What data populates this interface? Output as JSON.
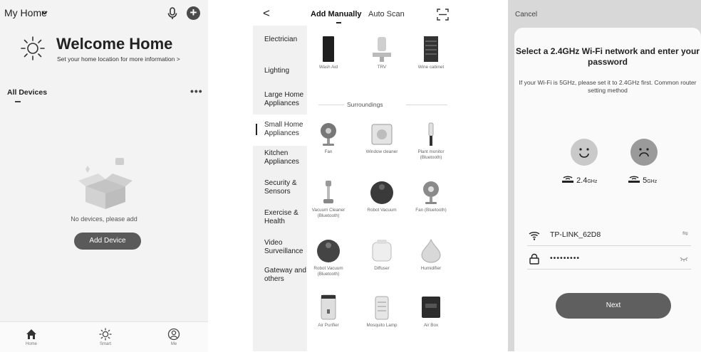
{
  "home": {
    "title": "My Home",
    "welcome": "Welcome Home",
    "location_hint": "Set your home location for more information >",
    "all_devices": "All Devices",
    "more": "•••",
    "empty_text": "No devices, please add",
    "add_device": "Add Device",
    "tabs": [
      {
        "label": "Home",
        "icon": "home-icon"
      },
      {
        "label": "Smart",
        "icon": "smart-sun-icon"
      },
      {
        "label": "Me",
        "icon": "profile-icon"
      }
    ]
  },
  "add": {
    "back": "<",
    "tab_manual": "Add Manually",
    "tab_auto": "Auto Scan",
    "categories": [
      "Electrician",
      "Lighting",
      "Large Home Appliances",
      "Small Home Appliances",
      "Kitchen Appliances",
      "Security & Sensors",
      "Exercise & Health",
      "Video Surveillance",
      "Gateway and others"
    ],
    "active_category": "Small Home Appliances",
    "top_items": [
      "Wash Aid",
      "TRV",
      "Wine cabinet"
    ],
    "section": "Surroundings",
    "items": [
      "Fan",
      "Window cleaner",
      "Plant monitor (Bluetooth)",
      "Vacuum Cleaner (Bluetooth)",
      "Robot Vacuum",
      "Fan (Bluetooth)",
      "Robot Vacuum (Bluetooth)",
      "Diffuser",
      "Humidifier",
      "Air Purifier",
      "Mosquito Lamp",
      "Air Box"
    ]
  },
  "wifi": {
    "cancel": "Cancel",
    "title": "Select a 2.4GHz Wi-Fi network and enter your password",
    "hint": "If your Wi-Fi is 5GHz, please set it to 2.4GHz first. Common router setting method",
    "band_24": "2.4",
    "band_24_unit": "GHz",
    "band_5": "5",
    "band_5_unit": "GHz",
    "ssid": "TP-LINK_62D8",
    "password_mask": "•••••••••",
    "next": "Next"
  }
}
